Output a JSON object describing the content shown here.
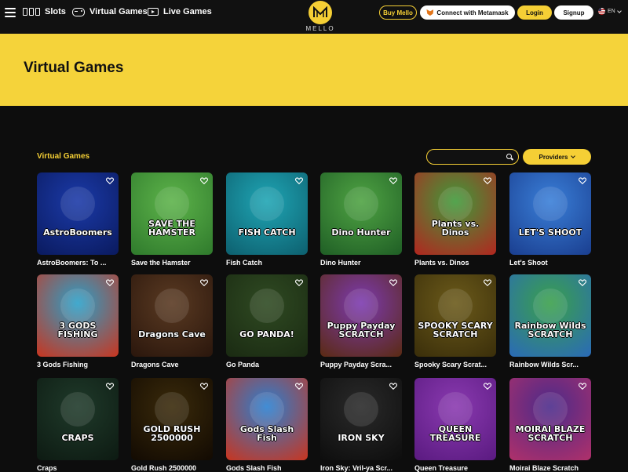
{
  "header": {
    "nav": [
      {
        "label": "Slots",
        "icon": "slots-icon"
      },
      {
        "label": "Virtual Games",
        "icon": "gamepad-icon"
      },
      {
        "label": "Live Games",
        "icon": "live-icon"
      }
    ],
    "logo_text": "MELLO",
    "buy_label": "Buy Mello",
    "metamask_label": "Connect with Metamask",
    "login_label": "Login",
    "signup_label": "Signup",
    "lang_label": "EN"
  },
  "banner": {
    "title": "Virtual Games"
  },
  "section": {
    "title": "Virtual Games",
    "search_placeholder": "",
    "providers_label": "Providers"
  },
  "games": [
    {
      "name": "AstroBoomers: To ...",
      "art": "AstroBoomers",
      "bg1": "#1b3aa8",
      "bg2": "#0a1a5e"
    },
    {
      "name": "Save the Hamster",
      "art": "SAVE THE HAMSTER",
      "bg1": "#5db34a",
      "bg2": "#2f7a2c"
    },
    {
      "name": "Fish Catch",
      "art": "FISH CATCH",
      "bg1": "#1fa5b4",
      "bg2": "#0d5f6e"
    },
    {
      "name": "Dino Hunter",
      "art": "Dino Hunter",
      "bg1": "#4fa343",
      "bg2": "#1f5e25"
    },
    {
      "name": "Plants vs. Dinos",
      "art": "Plants vs. Dinos",
      "bg1": "#3f9a3a",
      "bg2": "#b2261f"
    },
    {
      "name": "Let's Shoot",
      "art": "LET'S SHOOT",
      "bg1": "#3a7fd8",
      "bg2": "#1a3e8f"
    },
    {
      "name": "3 Gods Fishing",
      "art": "3 GODS FISHING",
      "bg1": "#2aa0c9",
      "bg2": "#c9351f"
    },
    {
      "name": "Dragons Cave",
      "art": "Dragons Cave",
      "bg1": "#5a3a22",
      "bg2": "#2a160c"
    },
    {
      "name": "Go Panda",
      "art": "GO PANDA!",
      "bg1": "#2f4a22",
      "bg2": "#1a2a12"
    },
    {
      "name": "Puppy Payday Scra...",
      "art": "Puppy Payday SCRATCH",
      "bg1": "#7c3ab0",
      "bg2": "#5a2a12"
    },
    {
      "name": "Spooky Scary Scrat...",
      "art": "SPOOKY SCARY SCRATCH",
      "bg1": "#6b5a1a",
      "bg2": "#3a2e0a"
    },
    {
      "name": "Rainbow Wilds Scr...",
      "art": "Rainbow Wilds SCRATCH",
      "bg1": "#3aa04a",
      "bg2": "#2a6ab8"
    },
    {
      "name": "Craps",
      "art": "CRAPS",
      "bg1": "#1f3a2a",
      "bg2": "#0d1a12"
    },
    {
      "name": "Gold Rush 2500000",
      "art": "GOLD RUSH 2500000",
      "bg1": "#3a2a0a",
      "bg2": "#120a02"
    },
    {
      "name": "Gods Slash Fish",
      "art": "Gods Slash Fish",
      "bg1": "#2a7fd0",
      "bg2": "#c9351f"
    },
    {
      "name": "Iron Sky: Vril-ya Scr...",
      "art": "IRON SKY",
      "bg1": "#2a2a2a",
      "bg2": "#0d0d0d"
    },
    {
      "name": "Queen Treasure",
      "art": "QUEEN TREASURE",
      "bg1": "#8a3ab0",
      "bg2": "#5a1a80"
    },
    {
      "name": "Moirai Blaze Scratch",
      "art": "MOIRAI BLAZE SCRATCH",
      "bg1": "#4a2a8a",
      "bg2": "#b0306a"
    }
  ],
  "colors": {
    "accent": "#f5cf35",
    "background": "#0d0d0d"
  }
}
